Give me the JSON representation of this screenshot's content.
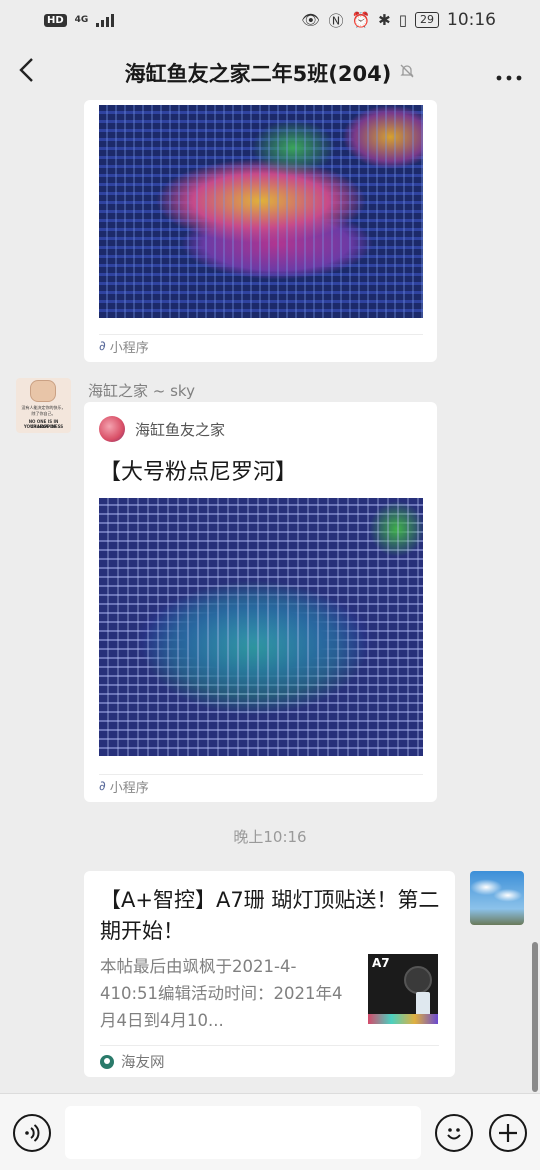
{
  "status_bar": {
    "hd": "HD",
    "network": "4G",
    "battery": "29",
    "time": "10:16"
  },
  "nav": {
    "back_icon": "chevron-left-icon",
    "title": "海缸鱼友之家二年5班(204)",
    "mute_icon": "bell-mute-icon",
    "more_icon": "more-dots-icon"
  },
  "messages": [
    {
      "type": "mini-program",
      "image": "coral-photo",
      "source": "小程序"
    },
    {
      "type": "mini-program",
      "sender": "海缸之家 ~ sky",
      "app_name": "海缸鱼友之家",
      "title": "【大号粉点尼罗河】",
      "image": "coral-photo",
      "source": "小程序",
      "avatar_text": [
        "没有人能决定你的快乐，",
        "除了你自己。",
        "NO ONE IS IN CHARGE OF",
        "YOUR HAPPINESS"
      ]
    },
    {
      "type": "link-card",
      "title": "【A+智控】A7珊 瑚灯顶贴送！第二期开始！",
      "description": "本帖最后由飒枫于2021-4-410:51编辑活动时间：2021年4月4日到4月10...",
      "thumb_label": "A7",
      "source": "海友网"
    }
  ],
  "timestamp": "晚上10:16",
  "input_bar": {
    "voice_icon": "voice-icon",
    "emoji_icon": "emoji-icon",
    "plus_icon": "plus-icon",
    "placeholder": ""
  }
}
